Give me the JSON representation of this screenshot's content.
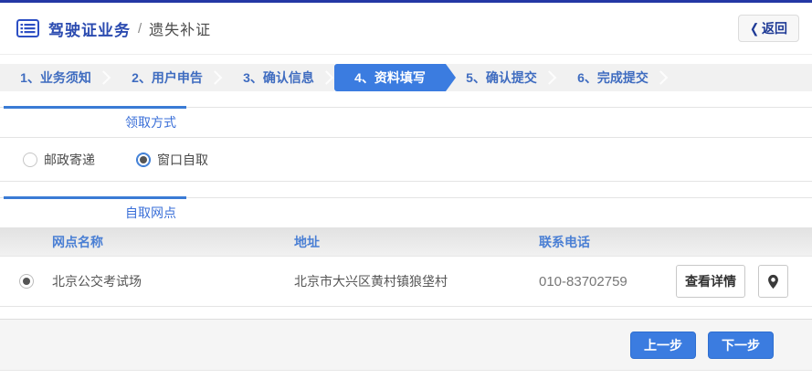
{
  "header": {
    "title": "驾驶证业务",
    "separator": "/",
    "subtitle": "遗失补证",
    "back_chevron": "❮",
    "back_label": "返回"
  },
  "steps": {
    "items": [
      {
        "label": "1、业务须知",
        "active": false
      },
      {
        "label": "2、用户申告",
        "active": false
      },
      {
        "label": "3、确认信息",
        "active": false
      },
      {
        "label": "4、资料填写",
        "active": true
      },
      {
        "label": "5、确认提交",
        "active": false
      },
      {
        "label": "6、完成提交",
        "active": false
      }
    ]
  },
  "pickup": {
    "title": "领取方式",
    "options": [
      {
        "label": "邮政寄递",
        "selected": false
      },
      {
        "label": "窗口自取",
        "selected": true
      }
    ]
  },
  "outlets": {
    "title": "自取网点",
    "columns": [
      "网点名称",
      "地址",
      "联系电话"
    ],
    "rows": [
      {
        "selected": true,
        "name": "北京公交考试场",
        "address": "北京市大兴区黄村镇狼垡村",
        "phone": "010-83702759",
        "detail_button": "查看详情"
      }
    ]
  },
  "footer": {
    "prev_label": "上一步",
    "next_label": "下一步"
  },
  "colors": {
    "accent_blue": "#3b7ce0",
    "topbar_blue": "#2438a5",
    "title_blue": "#2b4bb0",
    "step_text_blue": "#3f6cc0",
    "section_title_blue": "#3a6fd8",
    "table_header_blue": "#4a7fd4",
    "body_text": "#555555",
    "footer_gray": "#f5f5f5"
  }
}
